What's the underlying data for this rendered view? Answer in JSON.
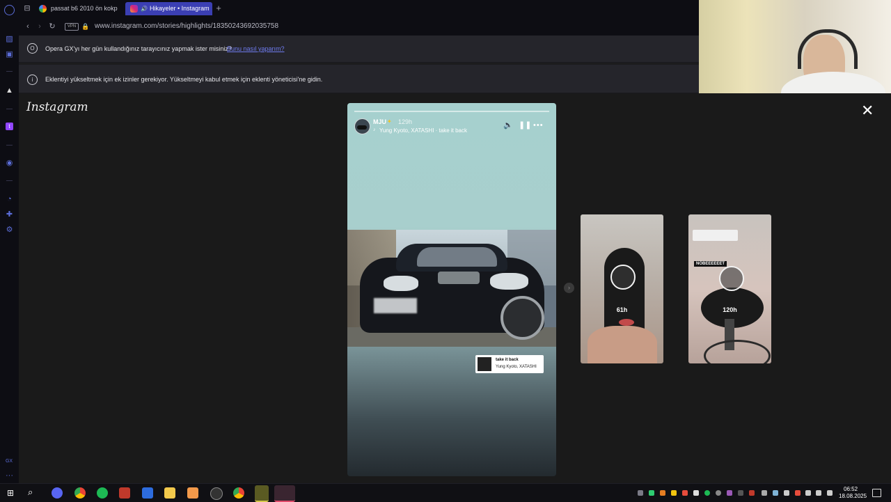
{
  "tabs": [
    {
      "label": "passat b6 2010 ön kokpit",
      "icon": "google-icon"
    },
    {
      "label": "Hikayeler • Instagram",
      "icon": "instagram-icon",
      "active": true
    }
  ],
  "addressbar": {
    "vpn_label": "VPN",
    "url": "www.instagram.com/stories/highlights/18350243692035758"
  },
  "default_browser_bar": {
    "text": "Opera GX'yı her gün kullandığınız tarayıcınız yapmak ister misiniz?",
    "link": "Bunu nasıl yaparım?"
  },
  "extension_bar": {
    "text": "Eklentiyi yükseltmek için ek izinler gerekiyor. Yükseltmeyi kabul etmek için eklenti yöneticisi'ne gidin."
  },
  "instagram": {
    "logo": "Instagram"
  },
  "story": {
    "username": "MJU",
    "time": "129h",
    "music": "Yung Kyoto, XATASHI · take it back",
    "sticker_title": "take it back",
    "sticker_artist": "Yung Kyoto, XATASHI"
  },
  "previews": [
    {
      "time": "61h"
    },
    {
      "time": "120h",
      "caption": "NÖBEEEEEET"
    }
  ],
  "sidebar": {
    "gx_label": "GX"
  },
  "clock": {
    "time": "06:52",
    "date": "18.08.2025"
  },
  "colors": {
    "active_tab": "#3b3fb3",
    "sidebar_accent": "#5b6dd8",
    "link": "#6f7cf0"
  }
}
